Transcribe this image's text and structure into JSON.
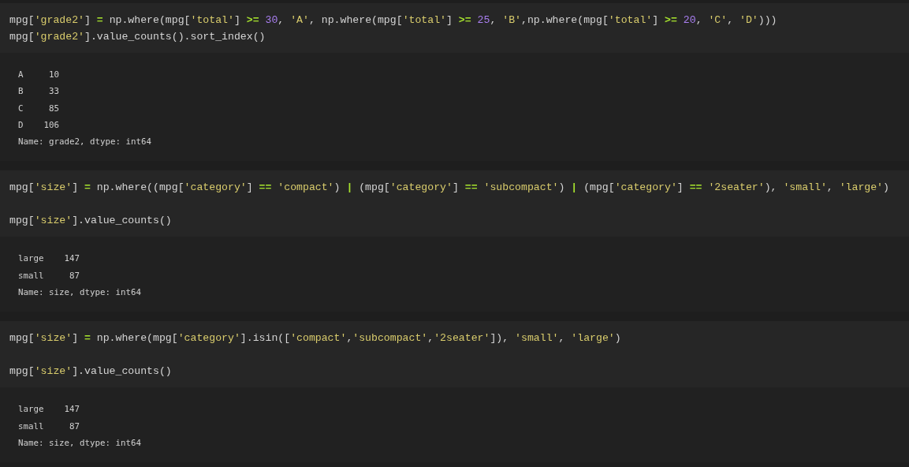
{
  "cells": [
    {
      "code": [
        [
          [
            {
              "kind": "plain",
              "text": "mpg["
            },
            {
              "kind": "string",
              "text": "'grade2'"
            },
            {
              "kind": "plain",
              "text": "] "
            },
            {
              "kind": "operator",
              "text": "= "
            },
            {
              "kind": "plain",
              "text": "np.where(mpg["
            },
            {
              "kind": "string",
              "text": "'total'"
            },
            {
              "kind": "plain",
              "text": "] "
            },
            {
              "kind": "operator",
              "text": ">= "
            },
            {
              "kind": "number",
              "text": "30"
            },
            {
              "kind": "plain",
              "text": ", "
            },
            {
              "kind": "string",
              "text": "'A'"
            },
            {
              "kind": "plain",
              "text": ", np.where(mpg["
            },
            {
              "kind": "string",
              "text": "'total'"
            },
            {
              "kind": "plain",
              "text": "] "
            },
            {
              "kind": "operator",
              "text": ">= "
            },
            {
              "kind": "number",
              "text": "25"
            },
            {
              "kind": "plain",
              "text": ", "
            },
            {
              "kind": "string",
              "text": "'B'"
            },
            {
              "kind": "plain",
              "text": ",np.where(mpg["
            },
            {
              "kind": "string",
              "text": "'total'"
            },
            {
              "kind": "plain",
              "text": "] "
            },
            {
              "kind": "operator",
              "text": ">= "
            },
            {
              "kind": "number",
              "text": "20"
            },
            {
              "kind": "plain",
              "text": ", "
            },
            {
              "kind": "string",
              "text": "'C'"
            },
            {
              "kind": "plain",
              "text": ", "
            },
            {
              "kind": "string",
              "text": "'D'"
            },
            {
              "kind": "plain",
              "text": ")))"
            }
          ],
          [
            {
              "kind": "plain",
              "text": "mpg["
            },
            {
              "kind": "string",
              "text": "'grade2'"
            },
            {
              "kind": "plain",
              "text": "].value_counts().sort_index()"
            }
          ]
        ]
      ],
      "output": [
        "A     10",
        "B     33",
        "C     85",
        "D    106",
        "Name: grade2, dtype: int64"
      ]
    },
    {
      "code": [
        [
          [
            {
              "kind": "plain",
              "text": "mpg["
            },
            {
              "kind": "string",
              "text": "'size'"
            },
            {
              "kind": "plain",
              "text": "] "
            },
            {
              "kind": "operator",
              "text": "= "
            },
            {
              "kind": "plain",
              "text": "np.where((mpg["
            },
            {
              "kind": "string",
              "text": "'category'"
            },
            {
              "kind": "plain",
              "text": "] "
            },
            {
              "kind": "operator",
              "text": "== "
            },
            {
              "kind": "string",
              "text": "'compact'"
            },
            {
              "kind": "plain",
              "text": ") "
            },
            {
              "kind": "operator",
              "text": "| "
            },
            {
              "kind": "plain",
              "text": "(mpg["
            },
            {
              "kind": "string",
              "text": "'category'"
            },
            {
              "kind": "plain",
              "text": "] "
            },
            {
              "kind": "operator",
              "text": "== "
            },
            {
              "kind": "string",
              "text": "'subcompact'"
            },
            {
              "kind": "plain",
              "text": ") "
            },
            {
              "kind": "operator",
              "text": "| "
            },
            {
              "kind": "plain",
              "text": "(mpg["
            },
            {
              "kind": "string",
              "text": "'category'"
            },
            {
              "kind": "plain",
              "text": "] "
            },
            {
              "kind": "operator",
              "text": "== "
            },
            {
              "kind": "string",
              "text": "'2seater'"
            },
            {
              "kind": "plain",
              "text": "), "
            },
            {
              "kind": "string",
              "text": "'small'"
            },
            {
              "kind": "plain",
              "text": ", "
            },
            {
              "kind": "string",
              "text": "'large'"
            },
            {
              "kind": "plain",
              "text": ")"
            }
          ]
        ],
        [
          [
            {
              "kind": "plain",
              "text": "mpg["
            },
            {
              "kind": "string",
              "text": "'size'"
            },
            {
              "kind": "plain",
              "text": "].value_counts()"
            }
          ]
        ]
      ],
      "output": [
        "large    147",
        "small     87",
        "Name: size, dtype: int64"
      ]
    },
    {
      "code": [
        [
          [
            {
              "kind": "plain",
              "text": "mpg["
            },
            {
              "kind": "string",
              "text": "'size'"
            },
            {
              "kind": "plain",
              "text": "] "
            },
            {
              "kind": "operator",
              "text": "= "
            },
            {
              "kind": "plain",
              "text": "np.where(mpg["
            },
            {
              "kind": "string",
              "text": "'category'"
            },
            {
              "kind": "plain",
              "text": "].isin(["
            },
            {
              "kind": "string",
              "text": "'compact'"
            },
            {
              "kind": "plain",
              "text": ","
            },
            {
              "kind": "string",
              "text": "'subcompact'"
            },
            {
              "kind": "plain",
              "text": ","
            },
            {
              "kind": "string",
              "text": "'2seater'"
            },
            {
              "kind": "plain",
              "text": "]), "
            },
            {
              "kind": "string",
              "text": "'small'"
            },
            {
              "kind": "plain",
              "text": ", "
            },
            {
              "kind": "string",
              "text": "'large'"
            },
            {
              "kind": "plain",
              "text": ")"
            }
          ]
        ],
        [
          [
            {
              "kind": "plain",
              "text": "mpg["
            },
            {
              "kind": "string",
              "text": "'size'"
            },
            {
              "kind": "plain",
              "text": "].value_counts()"
            }
          ]
        ]
      ],
      "output": [
        "large    147",
        "small     87",
        "Name: size, dtype: int64"
      ]
    }
  ]
}
